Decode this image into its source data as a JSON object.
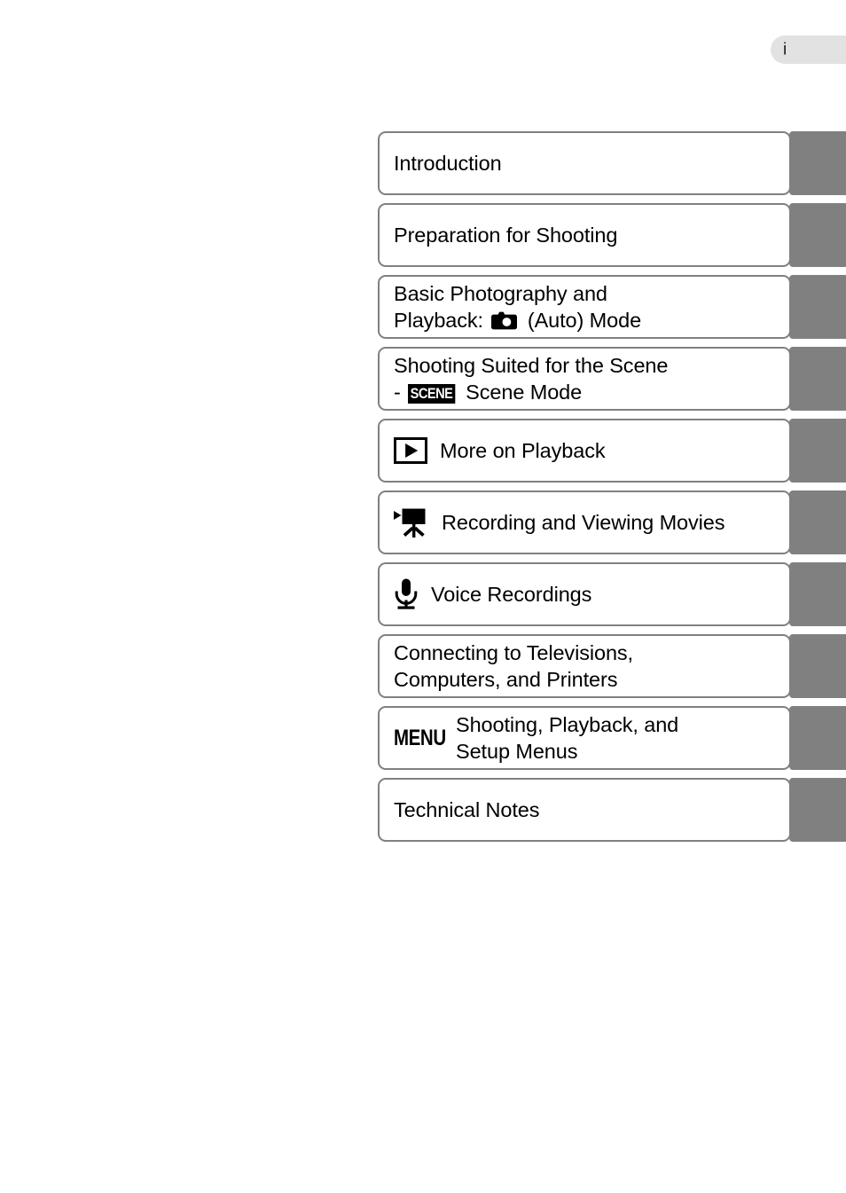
{
  "page": {
    "number_label": "i"
  },
  "chapter_index": {
    "items": [
      {
        "id": "introduction",
        "icon": null,
        "label": "Introduction",
        "lines": [
          "Introduction"
        ]
      },
      {
        "id": "preparation-for-shooting",
        "icon": null,
        "label": "Preparation for Shooting",
        "lines": [
          "Preparation for Shooting"
        ]
      },
      {
        "id": "basic-photography-and-playback",
        "icon": null,
        "label": "Basic Photography and Playback: ■ (Auto) Mode",
        "line1": "Basic Photography and",
        "line2_before": "Playback: ",
        "line2_icon": "camera-icon",
        "line2_after": " (Auto) Mode"
      },
      {
        "id": "shooting-suited-for-the-scene",
        "icon": null,
        "label": "Shooting Suited for the Scene - SCENE Scene Mode",
        "line1": "Shooting Suited for the Scene",
        "line2_before": "- ",
        "line2_badge": "SCENE",
        "line2_after": " Scene Mode"
      },
      {
        "id": "more-on-playback",
        "icon": "playback-icon",
        "label": "More on Playback",
        "lines": [
          "More on Playback"
        ]
      },
      {
        "id": "recording-and-viewing-movies",
        "icon": "movie-camera-icon",
        "label": "Recording and Viewing Movies",
        "lines": [
          "Recording and Viewing Movies"
        ]
      },
      {
        "id": "voice-recordings",
        "icon": "microphone-icon",
        "label": "Voice Recordings",
        "lines": [
          "Voice Recordings"
        ]
      },
      {
        "id": "connecting-to-televisions-computers-printers",
        "icon": null,
        "label": "Connecting to Televisions, Computers, and Printers",
        "line1": "Connecting to Televisions,",
        "line2": "Computers, and Printers"
      },
      {
        "id": "shooting-playback-and-setup-menus",
        "icon": "menu-wordmark",
        "icon_text": "MENU",
        "label": "Shooting, Playback, and Setup Menus",
        "line1": "Shooting, Playback, and",
        "line2": "Setup Menus"
      },
      {
        "id": "technical-notes",
        "icon": null,
        "label": "Technical Notes",
        "lines": [
          "Technical Notes"
        ]
      }
    ]
  },
  "colors": {
    "tab_gray": "#808080",
    "card_border": "#808080",
    "page_pill": "#e2e2e2",
    "text": "#000000",
    "card_background": "#ffffff"
  }
}
